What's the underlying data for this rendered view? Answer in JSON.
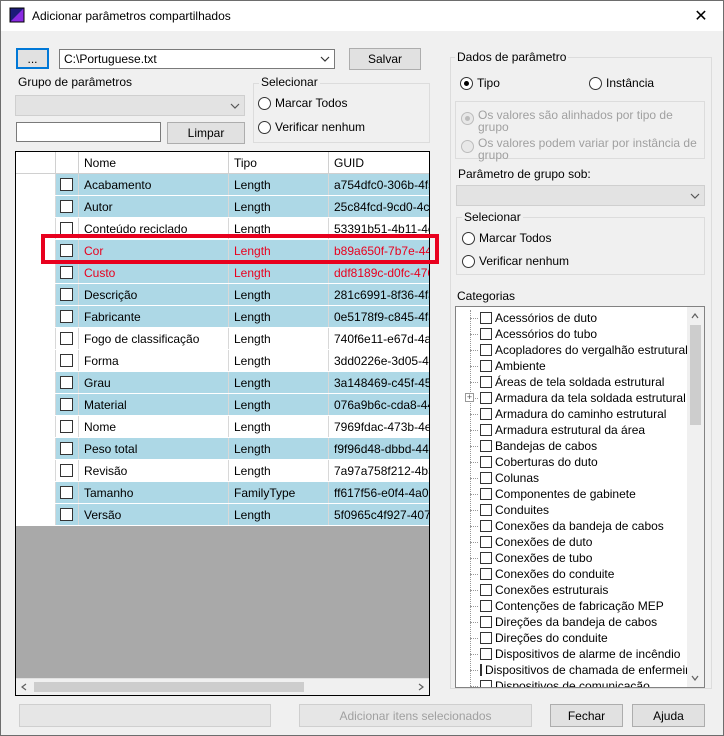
{
  "window": {
    "title": "Adicionar parâmetros compartilhados",
    "close_glyph": "✕"
  },
  "file": {
    "browse_label": "...",
    "path": "C:\\Portuguese.txt",
    "save_label": "Salvar"
  },
  "param_group": {
    "label": "Grupo de parâmetros",
    "selected": "",
    "filter_value": "",
    "clear_label": "Limpar"
  },
  "select_box": {
    "title": "Selecionar",
    "check_all": "Marcar Todos",
    "check_none": "Verificar nenhum"
  },
  "grid": {
    "columns": [
      "Nome",
      "Tipo",
      "GUID"
    ],
    "rows": [
      {
        "name": "Acabamento",
        "type": "Length",
        "guid": "a754dfc0-306b-4f5f-8",
        "style": "blue"
      },
      {
        "name": "Autor",
        "type": "Length",
        "guid": "25c84fcd-9cd0-4cfa-",
        "style": "blue"
      },
      {
        "name": "Conteúdo reciclado",
        "type": "Length",
        "guid": "53391b51-4b11-4e8",
        "style": "white"
      },
      {
        "name": "Cor",
        "type": "Length",
        "guid": "b89a650f-7b7e-44ff-8",
        "style": "blue red"
      },
      {
        "name": "Custo",
        "type": "Length",
        "guid": "ddf8189c-d0fc-4764-",
        "style": "blue red"
      },
      {
        "name": "Descrição",
        "type": "Length",
        "guid": "281c6991-8f36-4f34-",
        "style": "blue"
      },
      {
        "name": "Fabricante",
        "type": "Length",
        "guid": "0e5178f9-c845-4f3c-",
        "style": "blue"
      },
      {
        "name": "Fogo de classificação",
        "type": "Length",
        "guid": "740f6e11-e67d-4ae7",
        "style": "white"
      },
      {
        "name": "Forma",
        "type": "Length",
        "guid": "3dd0226e-3d05-402a",
        "style": "white"
      },
      {
        "name": "Grau",
        "type": "Length",
        "guid": "3a148469-c45f-458a",
        "style": "blue"
      },
      {
        "name": "Material",
        "type": "Length",
        "guid": "076a9b6c-cda8-44ea",
        "style": "blue"
      },
      {
        "name": "Nome",
        "type": "Length",
        "guid": "7969fdac-473b-4e59",
        "style": "white"
      },
      {
        "name": "Peso total",
        "type": "Length",
        "guid": "f9f96d48-dbbd-4424-",
        "style": "blue"
      },
      {
        "name": "Revisão",
        "type": "Length",
        "guid": "7a97a758f212-4b3d",
        "style": "white"
      },
      {
        "name": "Tamanho",
        "type": "FamilyType",
        "guid": "ff617f56-e0f4-4a07-a",
        "style": "blue"
      },
      {
        "name": "Versão",
        "type": "Length",
        "guid": "5f0965c4f927-407e-",
        "style": "blue"
      }
    ]
  },
  "param_data": {
    "title": "Dados de parâmetro",
    "type_option": "Tipo",
    "instance_option": "Instância",
    "aligned_option": "Os valores são alinhados por tipo de grupo",
    "vary_option": "Os valores podem variar por instância de grupo",
    "group_under_label": "Parâmetro de grupo sob:",
    "group_under_value": ""
  },
  "select_box_2": {
    "title": "Selecionar",
    "check_all": "Marcar Todos",
    "check_none": "Verificar nenhum"
  },
  "categories": {
    "label": "Categorias",
    "items": [
      {
        "label": "Acessórios de duto",
        "expandable": false
      },
      {
        "label": "Acessórios do tubo",
        "expandable": false
      },
      {
        "label": "Acopladores do vergalhão estrutural",
        "expandable": false
      },
      {
        "label": "Ambiente",
        "expandable": false
      },
      {
        "label": "Áreas de tela soldada estrutural",
        "expandable": false
      },
      {
        "label": "Armadura da tela soldada estrutural",
        "expandable": true
      },
      {
        "label": "Armadura do caminho estrutural",
        "expandable": false
      },
      {
        "label": "Armadura estrutural da área",
        "expandable": false
      },
      {
        "label": "Bandejas de cabos",
        "expandable": false
      },
      {
        "label": "Coberturas do duto",
        "expandable": false
      },
      {
        "label": "Colunas",
        "expandable": false
      },
      {
        "label": "Componentes de gabinete",
        "expandable": false
      },
      {
        "label": "Conduites",
        "expandable": false
      },
      {
        "label": "Conexões da bandeja de cabos",
        "expandable": false
      },
      {
        "label": "Conexões de duto",
        "expandable": false
      },
      {
        "label": "Conexões de tubo",
        "expandable": false
      },
      {
        "label": "Conexões do conduite",
        "expandable": false
      },
      {
        "label": "Conexões estruturais",
        "expandable": false
      },
      {
        "label": "Contenções de fabricação MEP",
        "expandable": false
      },
      {
        "label": "Direções da bandeja de cabos",
        "expandable": false
      },
      {
        "label": "Direções do conduite",
        "expandable": false
      },
      {
        "label": "Dispositivos de alarme de incêndio",
        "expandable": false
      },
      {
        "label": "Dispositivos de chamada de enfermeira",
        "expandable": false
      },
      {
        "label": "Dispositivos de comunicação",
        "expandable": false
      }
    ]
  },
  "footer": {
    "add_selected_label": "Adicionar itens selecionados",
    "close_label": "Fechar",
    "help_label": "Ajuda"
  }
}
